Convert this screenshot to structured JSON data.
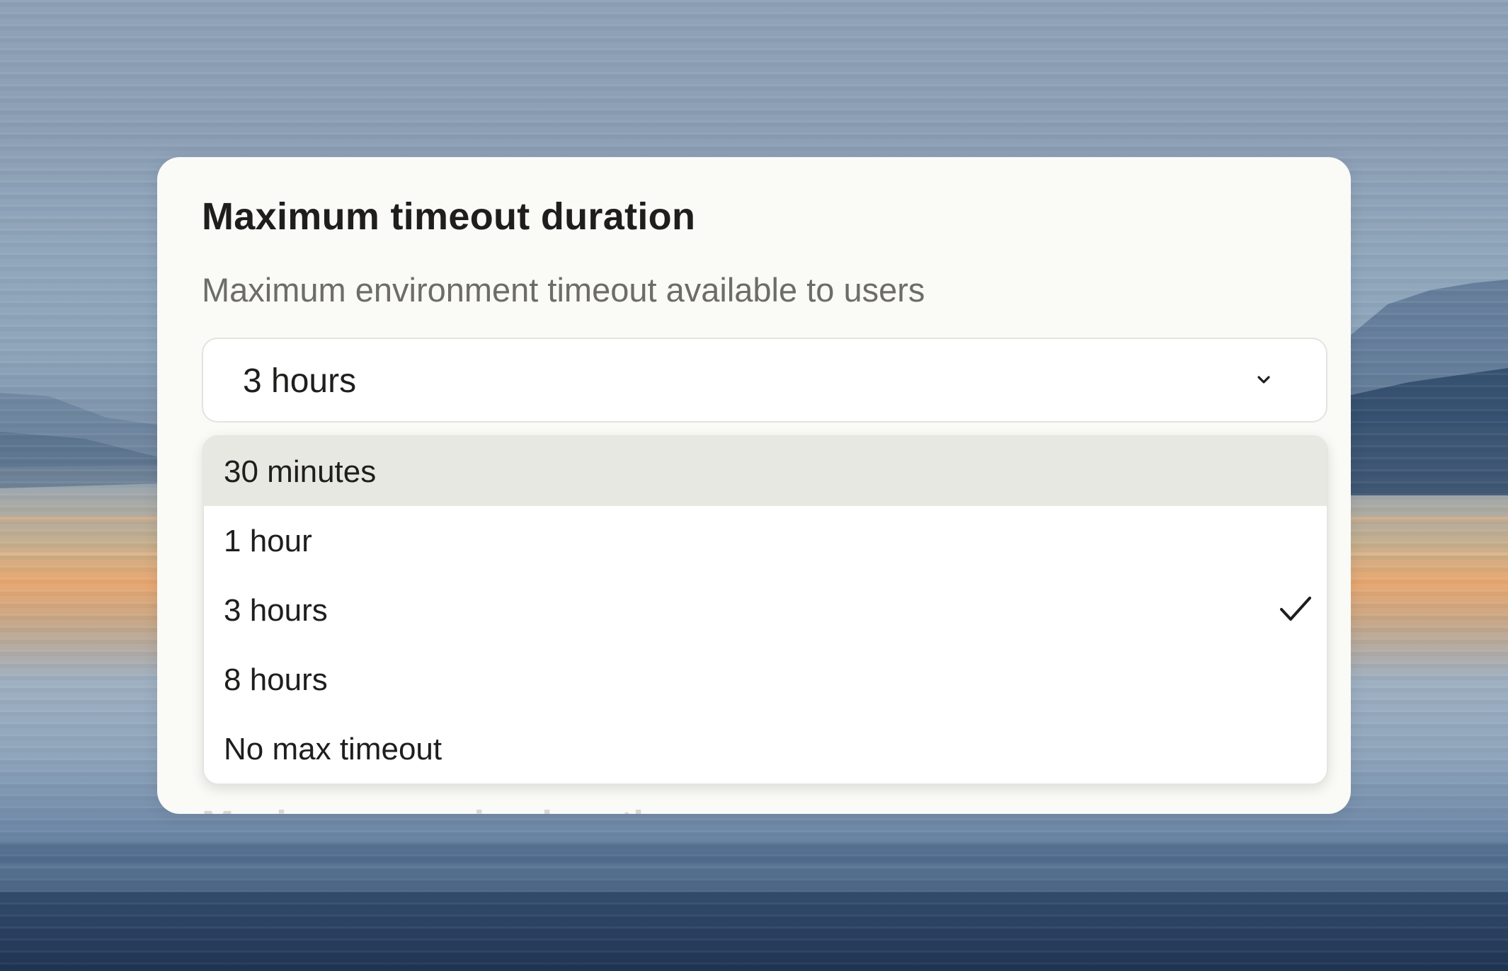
{
  "setting": {
    "title": "Maximum timeout duration",
    "description": "Maximum environment timeout available to users",
    "next_heading_partial": "Maximum session length"
  },
  "select": {
    "value": "3 hours",
    "chevron_icon": "chevron-down-icon"
  },
  "dropdown": {
    "highlighted_index": 0,
    "selected_index": 2,
    "options": [
      {
        "label": "30 minutes"
      },
      {
        "label": "1 hour"
      },
      {
        "label": "3 hours"
      },
      {
        "label": "8 hours"
      },
      {
        "label": "No max timeout"
      }
    ],
    "check_icon": "checkmark-icon"
  },
  "colors": {
    "card_background": "#fafaf7",
    "highlight_background": "#e8e8e3",
    "text_primary": "#1f1e1d",
    "text_secondary": "#6e6c67"
  }
}
